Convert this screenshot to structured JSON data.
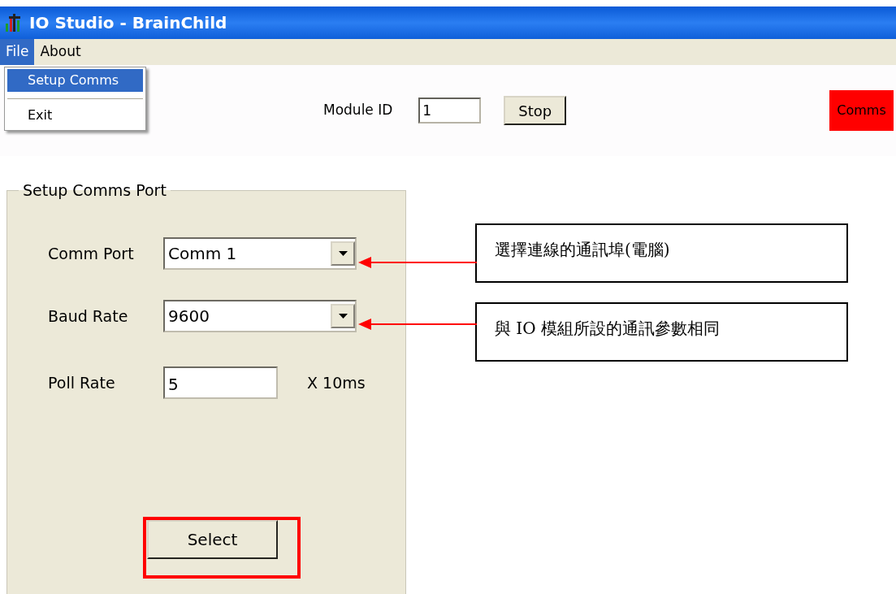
{
  "window": {
    "title": "IO Studio - BrainChild"
  },
  "menu": [
    {
      "label": "File",
      "selected": true
    },
    {
      "label": "About",
      "selected": false
    }
  ],
  "file_menu": [
    {
      "label": "Setup Comms",
      "selected": true
    },
    {
      "label": "Exit",
      "selected": false
    }
  ],
  "toolbar": {
    "module_id_label": "Module ID",
    "module_id": "1",
    "stop_button": "Stop",
    "comms_indicator": {
      "label": "Comms",
      "active": false
    }
  },
  "setup": {
    "title": "Setup Comms Port",
    "fields": [
      {
        "kind": "combo",
        "label": "Comm Port",
        "value": "Comm 1"
      },
      {
        "kind": "combo",
        "label": "Baud Rate",
        "value": "9600"
      },
      {
        "kind": "text",
        "label": "Poll Rate",
        "value": "5",
        "unit": "X 10ms"
      }
    ],
    "select_button": "Select"
  },
  "annotations": [
    "選擇連線的通訊埠(電腦)",
    "與 IO 模組所設的通訊參數相同"
  ]
}
